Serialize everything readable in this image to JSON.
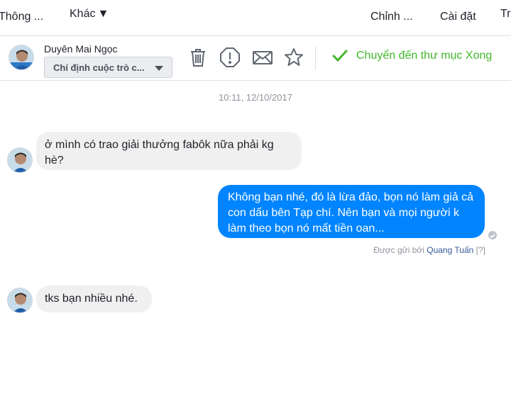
{
  "topnav": {
    "items": [
      "Thông ...",
      "Khác",
      "Chỉnh ...",
      "Cài đặt",
      "Tr"
    ]
  },
  "header": {
    "contact_name": "Duyên Mai Ngọc",
    "assign_label": "Chỉ định cuộc trò c...",
    "tools": [
      "trash-icon",
      "alert-icon",
      "mail-icon",
      "star-icon"
    ],
    "done_label": "Chuyển đến thư mục Xong"
  },
  "conversation": {
    "timestamp": "10:11, 12/10/2017",
    "messages": [
      {
        "side": "incoming",
        "text": "ở mình có trao giải thưởng fabôk nữa phải kg hè?"
      },
      {
        "side": "outgoing",
        "text": "Không bạn nhé, đó là lừa đảo, bọn nó làm giả cả con dấu bên Tạp chí. Nên bạn và mọi người k làm theo bọn nó mất tiền oan..."
      },
      {
        "side": "incoming",
        "text": "tks bạn nhiều nhé."
      }
    ],
    "sent_by_prefix": "Được gửi bởi",
    "sent_by_name": "Quang Tuấn",
    "sent_by_help": "[?]"
  },
  "colors": {
    "accent": "#0084ff",
    "done": "#42b72a",
    "incoming_bubble": "#f1f0f0"
  }
}
